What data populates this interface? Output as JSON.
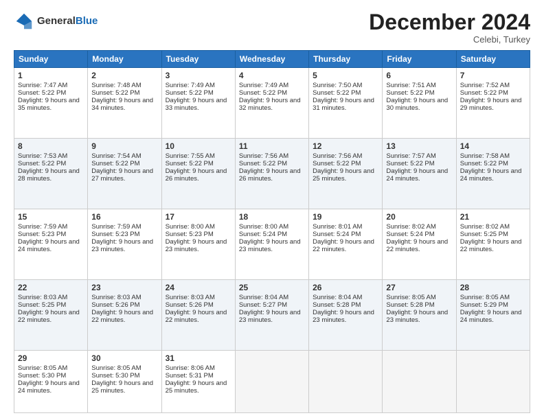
{
  "logo": {
    "line1": "General",
    "line2": "Blue"
  },
  "title": "December 2024",
  "location": "Celebi, Turkey",
  "headers": [
    "Sunday",
    "Monday",
    "Tuesday",
    "Wednesday",
    "Thursday",
    "Friday",
    "Saturday"
  ],
  "weeks": [
    [
      {
        "day": "1",
        "sunrise": "Sunrise: 7:47 AM",
        "sunset": "Sunset: 5:22 PM",
        "daylight": "Daylight: 9 hours and 35 minutes."
      },
      {
        "day": "2",
        "sunrise": "Sunrise: 7:48 AM",
        "sunset": "Sunset: 5:22 PM",
        "daylight": "Daylight: 9 hours and 34 minutes."
      },
      {
        "day": "3",
        "sunrise": "Sunrise: 7:49 AM",
        "sunset": "Sunset: 5:22 PM",
        "daylight": "Daylight: 9 hours and 33 minutes."
      },
      {
        "day": "4",
        "sunrise": "Sunrise: 7:49 AM",
        "sunset": "Sunset: 5:22 PM",
        "daylight": "Daylight: 9 hours and 32 minutes."
      },
      {
        "day": "5",
        "sunrise": "Sunrise: 7:50 AM",
        "sunset": "Sunset: 5:22 PM",
        "daylight": "Daylight: 9 hours and 31 minutes."
      },
      {
        "day": "6",
        "sunrise": "Sunrise: 7:51 AM",
        "sunset": "Sunset: 5:22 PM",
        "daylight": "Daylight: 9 hours and 30 minutes."
      },
      {
        "day": "7",
        "sunrise": "Sunrise: 7:52 AM",
        "sunset": "Sunset: 5:22 PM",
        "daylight": "Daylight: 9 hours and 29 minutes."
      }
    ],
    [
      {
        "day": "8",
        "sunrise": "Sunrise: 7:53 AM",
        "sunset": "Sunset: 5:22 PM",
        "daylight": "Daylight: 9 hours and 28 minutes."
      },
      {
        "day": "9",
        "sunrise": "Sunrise: 7:54 AM",
        "sunset": "Sunset: 5:22 PM",
        "daylight": "Daylight: 9 hours and 27 minutes."
      },
      {
        "day": "10",
        "sunrise": "Sunrise: 7:55 AM",
        "sunset": "Sunset: 5:22 PM",
        "daylight": "Daylight: 9 hours and 26 minutes."
      },
      {
        "day": "11",
        "sunrise": "Sunrise: 7:56 AM",
        "sunset": "Sunset: 5:22 PM",
        "daylight": "Daylight: 9 hours and 26 minutes."
      },
      {
        "day": "12",
        "sunrise": "Sunrise: 7:56 AM",
        "sunset": "Sunset: 5:22 PM",
        "daylight": "Daylight: 9 hours and 25 minutes."
      },
      {
        "day": "13",
        "sunrise": "Sunrise: 7:57 AM",
        "sunset": "Sunset: 5:22 PM",
        "daylight": "Daylight: 9 hours and 24 minutes."
      },
      {
        "day": "14",
        "sunrise": "Sunrise: 7:58 AM",
        "sunset": "Sunset: 5:22 PM",
        "daylight": "Daylight: 9 hours and 24 minutes."
      }
    ],
    [
      {
        "day": "15",
        "sunrise": "Sunrise: 7:59 AM",
        "sunset": "Sunset: 5:23 PM",
        "daylight": "Daylight: 9 hours and 24 minutes."
      },
      {
        "day": "16",
        "sunrise": "Sunrise: 7:59 AM",
        "sunset": "Sunset: 5:23 PM",
        "daylight": "Daylight: 9 hours and 23 minutes."
      },
      {
        "day": "17",
        "sunrise": "Sunrise: 8:00 AM",
        "sunset": "Sunset: 5:23 PM",
        "daylight": "Daylight: 9 hours and 23 minutes."
      },
      {
        "day": "18",
        "sunrise": "Sunrise: 8:00 AM",
        "sunset": "Sunset: 5:24 PM",
        "daylight": "Daylight: 9 hours and 23 minutes."
      },
      {
        "day": "19",
        "sunrise": "Sunrise: 8:01 AM",
        "sunset": "Sunset: 5:24 PM",
        "daylight": "Daylight: 9 hours and 22 minutes."
      },
      {
        "day": "20",
        "sunrise": "Sunrise: 8:02 AM",
        "sunset": "Sunset: 5:24 PM",
        "daylight": "Daylight: 9 hours and 22 minutes."
      },
      {
        "day": "21",
        "sunrise": "Sunrise: 8:02 AM",
        "sunset": "Sunset: 5:25 PM",
        "daylight": "Daylight: 9 hours and 22 minutes."
      }
    ],
    [
      {
        "day": "22",
        "sunrise": "Sunrise: 8:03 AM",
        "sunset": "Sunset: 5:25 PM",
        "daylight": "Daylight: 9 hours and 22 minutes."
      },
      {
        "day": "23",
        "sunrise": "Sunrise: 8:03 AM",
        "sunset": "Sunset: 5:26 PM",
        "daylight": "Daylight: 9 hours and 22 minutes."
      },
      {
        "day": "24",
        "sunrise": "Sunrise: 8:03 AM",
        "sunset": "Sunset: 5:26 PM",
        "daylight": "Daylight: 9 hours and 22 minutes."
      },
      {
        "day": "25",
        "sunrise": "Sunrise: 8:04 AM",
        "sunset": "Sunset: 5:27 PM",
        "daylight": "Daylight: 9 hours and 23 minutes."
      },
      {
        "day": "26",
        "sunrise": "Sunrise: 8:04 AM",
        "sunset": "Sunset: 5:28 PM",
        "daylight": "Daylight: 9 hours and 23 minutes."
      },
      {
        "day": "27",
        "sunrise": "Sunrise: 8:05 AM",
        "sunset": "Sunset: 5:28 PM",
        "daylight": "Daylight: 9 hours and 23 minutes."
      },
      {
        "day": "28",
        "sunrise": "Sunrise: 8:05 AM",
        "sunset": "Sunset: 5:29 PM",
        "daylight": "Daylight: 9 hours and 24 minutes."
      }
    ],
    [
      {
        "day": "29",
        "sunrise": "Sunrise: 8:05 AM",
        "sunset": "Sunset: 5:30 PM",
        "daylight": "Daylight: 9 hours and 24 minutes."
      },
      {
        "day": "30",
        "sunrise": "Sunrise: 8:05 AM",
        "sunset": "Sunset: 5:30 PM",
        "daylight": "Daylight: 9 hours and 25 minutes."
      },
      {
        "day": "31",
        "sunrise": "Sunrise: 8:06 AM",
        "sunset": "Sunset: 5:31 PM",
        "daylight": "Daylight: 9 hours and 25 minutes."
      },
      null,
      null,
      null,
      null
    ]
  ]
}
